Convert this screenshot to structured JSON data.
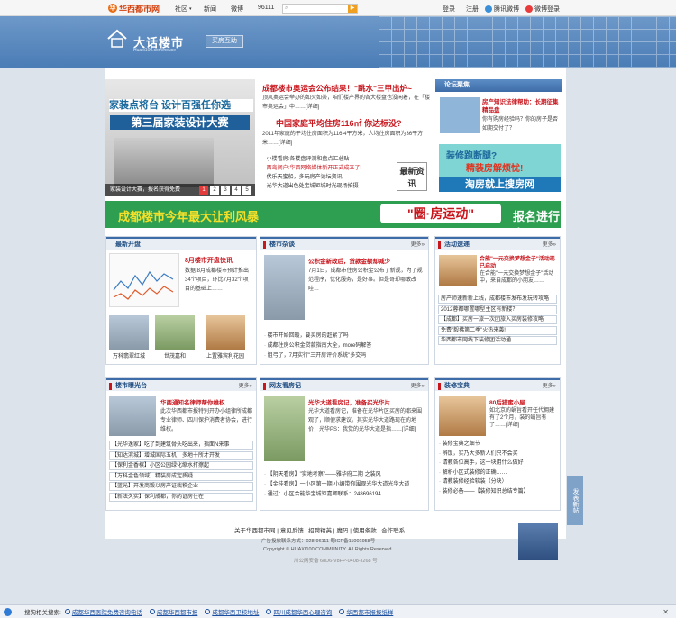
{
  "topbar": {
    "logo_text": "华西都市网",
    "logo_sub": "",
    "nav": [
      "社区",
      "新闻",
      "微博",
      "96111"
    ],
    "login": "登录",
    "register": "注册",
    "tencent_weibo": "腾讯微博",
    "weibo_login": "微博登录"
  },
  "header": {
    "title": "大话楼市",
    "subtitle": "Huaxi100.com/house",
    "button": "买房互助"
  },
  "slider": {
    "title1": "家装点将台 设计百强任你选",
    "title2": "第三届家装设计大赛",
    "caption": "家装设计大赛，报名获得免费",
    "pages": [
      "1",
      "2",
      "3",
      "4",
      "5"
    ]
  },
  "center": {
    "h1": "成都楼市奥运会公布结果！\"跳水\"三甲出炉~",
    "p1": "顶风奥运会举办的如火如荼，咱们楼产界的各大楼盘也没闲着，在「楼市奥运会」中……[详细]",
    "h2": "中国家庭平均住房116㎡ 你达标没?",
    "p2": "2011年家庭的平均住房面积为116.4平方米，人均住房面积为36平方米……[详细]",
    "list": [
      {
        "text": "小楼看房:各楼盘评测和盘点汇总贴",
        "red": false
      },
      {
        "text": "西岛闭户:华西网络媒体新开正式成立了!",
        "red": true
      },
      {
        "text": "伏乐天蜜船，多玩房产论坛资讯",
        "red": false
      },
      {
        "text": "光华大道出色处宝城钜城时光现场拍摄",
        "red": false
      }
    ],
    "badge": "最新资讯"
  },
  "forum": {
    "title": "论坛聚焦",
    "headline": "房产知识法律帮助：长期征集精品盘",
    "text": "你有购房经验吗？你的房子是否如期交付了？",
    "ad_line1": "装修跑断腿?",
    "ad_line2": "精装房解烦忧!",
    "ad_line3": "淘房就上搜房网"
  },
  "banner": {
    "text1": "成都楼市今年最大让利风暴",
    "text2": "\"圈·房运动\"",
    "text3": "报名进行中。。。"
  },
  "panel1": {
    "title": "最新开盘",
    "chart_title": "8月楼市开盘快讯",
    "text": "数据:8月成都楼市预计推出34个项目，环比7月32个项目的基础上……",
    "thumbs": [
      "万科翡翠红城",
      "世茂嘉和",
      "上置雅宾利花园"
    ]
  },
  "panel2": {
    "title": "楼市杂谈",
    "more": "更多»",
    "headline": "公积金新政后，贷款金额却减少",
    "text": "7月1日，成都市住房公积金公布了新规，为了规范程序，优化服务，是好事。但是哥却哪敢改哇…",
    "list": [
      "楼市开始回暖，要买房的赶紧了吗",
      "成都住房公积金贷款指南大全，more码解答",
      "姐弓了，7月实行\"三开房评价系统\"多交吗"
    ]
  },
  "panel3": {
    "title": "活动速递",
    "more": "更多»",
    "headline": "合能\"一元交换梦想金子\"活动现已启动",
    "text": "在合能\"一元交换梦想金子\"活动中，来自成都的小朋友……",
    "list": [
      "房产师速新新上线，成都楼市发布发玩转攻略",
      "2012蓉都哪置哪型主区有新楼？",
      "【成都】买房一旅一次团旅入买房装修攻略",
      "免费\"毅拂第二季\"火热来袭!",
      "华西都市网线下装修团活动通"
    ]
  },
  "panel4": {
    "title": "楼市曝光台",
    "more": "更多»",
    "headline": "华西通知名律师帮你维权",
    "text": "此次华西都市报特别开办小组律所成都专业律师、四川保护消费者协会，进行维权。",
    "list": [
      "【光华逸家】吃了到建筑骨头吃出来，指面N来事",
      "【知达滨城】增城国际五机，多地十所才开发",
      "【保利金香槟】小区公园绿化缩水打擦起",
      "【万科金色领域】精装房成定质疑",
      "【蓝光】开发商毁以房产证栽秩企业",
      "【新法久实】保利成都，你的证房住在"
    ]
  },
  "panel5": {
    "title": "网友看房记",
    "more": "更多»",
    "headline": "光华大道看房记，准备买光华片",
    "text": "光华大道看房记，准备在光华片区买房的都来围观了，顺便求建议。其实光华大道路现在的地价，光华PS：我觉的光华大道是指……[详细]",
    "list": [
      "【阴天看房】\"实地考察\"——雅华府二期 之装风",
      "【金桂看房】一小区第一期 小编带你围观光华大道光华大道",
      "通过：小区合能华宝城钜嘉卿联系：248696194"
    ]
  },
  "panel6": {
    "title": "装修宝典",
    "more": "更多»",
    "headline": "80后猎蜜小屋",
    "text": "如北京的蜗旨看开任代拥建有了2个月，装的蜗旨有了……[详细]",
    "list": [
      "装修宝典之细节",
      "辨饭，实乃大多新人们只不会买",
      "请教各位高手，这一块用什么做好",
      "解析小区式装修的正确……",
      "请教装修经验软装（分块）",
      "装修必备——【装修知识总结专篇】"
    ]
  },
  "footer": {
    "links": [
      "关于华西都市网",
      "意见反馈",
      "招聘精英",
      "魔码",
      "使用条款",
      "合作联系"
    ],
    "line1": "广告投放联系方式：028-96111  蜀ICP备11001958号",
    "line2": "Copyright © HUAXI100 COMMUNITY. All Rights Reserved.",
    "line3": "川公网安备 68D6-V8FP-0408-J268 号",
    "side_tab": "发表新帖"
  },
  "bottombar": {
    "label": "搜狗相关搜索:",
    "links": [
      "成都华西医院免费咨询电话",
      "成都华西都市报",
      "成都华西卫校地址",
      "四川成都华西心理咨询",
      "华西都市报报纸样"
    ]
  }
}
